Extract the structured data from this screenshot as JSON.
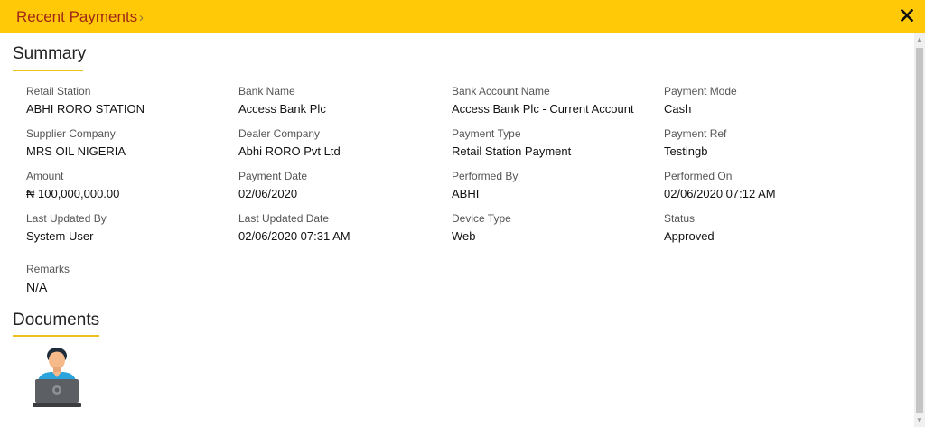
{
  "header": {
    "breadcrumb": "Recent Payments",
    "chevron": "›",
    "close_label": "✕"
  },
  "colors": {
    "header_bg": "#ffc907",
    "breadcrumb_text": "#a0271a",
    "accent_underline": "#f0c020"
  },
  "summary": {
    "title": "Summary",
    "fields": [
      {
        "label": "Retail Station",
        "value": "ABHI RORO STATION"
      },
      {
        "label": "Bank Name",
        "value": "Access Bank Plc"
      },
      {
        "label": "Bank Account Name",
        "value": "Access Bank Plc - Current Account"
      },
      {
        "label": "Payment Mode",
        "value": "Cash"
      },
      {
        "label": "Supplier Company",
        "value": "MRS OIL NIGERIA"
      },
      {
        "label": "Dealer Company",
        "value": "Abhi RORO Pvt Ltd"
      },
      {
        "label": "Payment Type",
        "value": "Retail Station Payment"
      },
      {
        "label": "Payment Ref",
        "value": "Testingb"
      },
      {
        "label": "Amount",
        "value": "₦ 100,000,000.00"
      },
      {
        "label": "Payment Date",
        "value": "02/06/2020"
      },
      {
        "label": "Performed By",
        "value": "ABHI"
      },
      {
        "label": "Performed On",
        "value": "02/06/2020 07:12 AM"
      },
      {
        "label": "Last Updated By",
        "value": "System User"
      },
      {
        "label": "Last Updated Date",
        "value": "02/06/2020 07:31 AM"
      },
      {
        "label": "Device Type",
        "value": "Web"
      },
      {
        "label": "Status",
        "value": "Approved"
      }
    ],
    "remarks": {
      "label": "Remarks",
      "value": "N/A"
    }
  },
  "documents": {
    "title": "Documents",
    "items": [
      {
        "icon": "user-laptop-icon"
      }
    ]
  }
}
